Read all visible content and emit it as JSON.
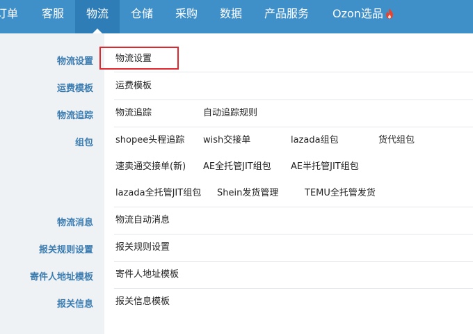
{
  "nav": {
    "items": [
      "订单",
      "客服",
      "物流",
      "仓储",
      "采购",
      "数据",
      "产品服务",
      "Ozon选品"
    ],
    "active": "物流",
    "hot_icon": "fire-icon"
  },
  "menu": {
    "rows": [
      {
        "label": "物流设置",
        "items": [
          "物流设置"
        ]
      },
      {
        "label": "运费模板",
        "items": [
          "运费模板"
        ]
      },
      {
        "label": "物流追踪",
        "items": [
          "物流追踪",
          "自动追踪规则"
        ]
      },
      {
        "label": "组包",
        "items": [
          "shopee头程追踪",
          "wish交接单",
          "lazada组包",
          "货代组包",
          "速卖通交接单(新)",
          "AE全托管JIT组包",
          "AE半托管JIT组包",
          "lazada全托管JIT组包",
          "Shein发货管理",
          "TEMU全托管发货"
        ]
      },
      {
        "label": "物流消息",
        "items": [
          "物流自动消息"
        ]
      },
      {
        "label": "报关规则设置",
        "items": [
          "报关规则设置"
        ]
      },
      {
        "label": "寄件人地址模板",
        "items": [
          "寄件人地址模板"
        ]
      },
      {
        "label": "报关信息",
        "items": [
          "报关信息模板"
        ]
      }
    ],
    "highlighted_item": "物流设置"
  },
  "colors": {
    "nav_bg": "#3f8fc8",
    "label_blue": "#3a7bb0",
    "highlight_red": "#e2262e",
    "fire_red": "#e8432e"
  }
}
